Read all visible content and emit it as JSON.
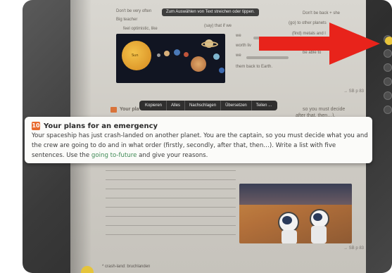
{
  "banner": {
    "text": "Zum Auswählen von Text streichen oder tippen."
  },
  "context_menu": {
    "items": [
      "Kopieren",
      "Alles",
      "Nachschlagen",
      "Übersetzen",
      "Teilen ..."
    ]
  },
  "lifted_text": {
    "number": "10",
    "title": "Your plans for an emergency",
    "body_part1": "Your spaceship has just crash-landed on another planet. You are the captain, so you must decide what you and the crew are going to do and in what order (firstly, secondly, after that, then…). Write a list with five sentences. Use the ",
    "highlight": "going to-future",
    "body_part2": " and give your reasons.",
    "highlight_color": "#3f8a55",
    "badge_color": "#e86a2e"
  },
  "background_page": {
    "top_left_1": "Don't be very often",
    "top_left_2": "Big teacher",
    "top_left_3": "feel optimistic, like",
    "top_mid": "(say) that if we",
    "top_right_1": "Don't be back + she",
    "top_right_2": "(go) to other planets",
    "top_right_3": "(find) metals and l",
    "mid_lines": [
      "we",
      "worth liv",
      "we",
      "them back to Earth."
    ],
    "mid_right": "be able to",
    "sun_label": "Sun",
    "page_ref_1": "→ SB p 83",
    "page_ref_2": "→ SB p 83",
    "footer": "* crash-land: bruchlanden",
    "behind_card_1": "Your pla",
    "behind_card_2": "so you must decide",
    "behind_card_3": "after that, then…)."
  },
  "arrow": {
    "color": "#e8231b"
  }
}
